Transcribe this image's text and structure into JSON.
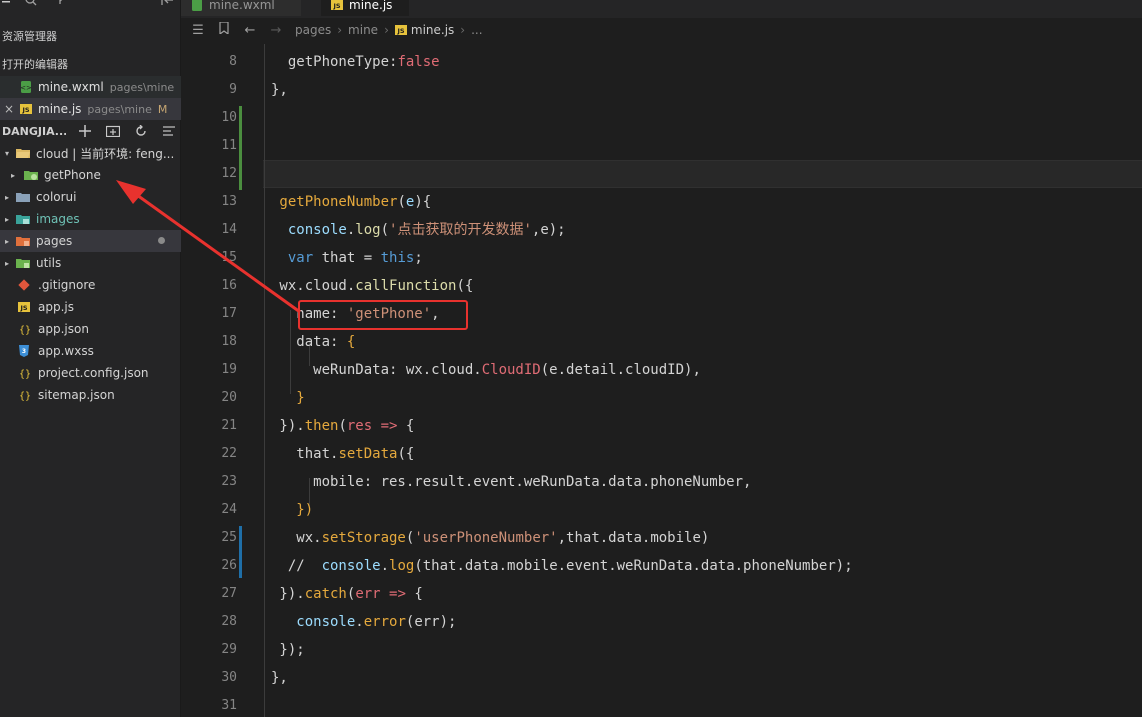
{
  "sidebar": {
    "panel_title": "资源管理器",
    "open_editors_title": "打开的编辑器",
    "open_editors": [
      {
        "name": "mine.wxml",
        "path": "pages\\mine",
        "modified": "",
        "close": ""
      },
      {
        "name": "mine.js",
        "path": "pages\\mine",
        "modified": "M",
        "close": "×"
      }
    ],
    "workspace_title": "DANGJIA...",
    "tree": [
      {
        "label": "cloud | 当前环境: feng...",
        "twisty": "▾",
        "icon": "folder-open-icon"
      },
      {
        "label": "getPhone",
        "twisty": "▸",
        "icon": "cloud-function-folder-icon"
      },
      {
        "label": "colorui",
        "twisty": "▸",
        "icon": "folder-icon"
      },
      {
        "label": "images",
        "twisty": "▸",
        "icon": "images-folder-icon"
      },
      {
        "label": "pages",
        "twisty": "▸",
        "icon": "pages-folder-icon"
      },
      {
        "label": "utils",
        "twisty": "▸",
        "icon": "utils-folder-icon"
      },
      {
        "label": ".gitignore",
        "twisty": "",
        "icon": "git-icon"
      },
      {
        "label": "app.js",
        "twisty": "",
        "icon": "js-file-icon"
      },
      {
        "label": "app.json",
        "twisty": "",
        "icon": "json-file-icon"
      },
      {
        "label": "app.wxss",
        "twisty": "",
        "icon": "css-file-icon"
      },
      {
        "label": "project.config.json",
        "twisty": "",
        "icon": "json-file-icon"
      },
      {
        "label": "sitemap.json",
        "twisty": "",
        "icon": "json-file-icon"
      }
    ]
  },
  "tabs": [
    {
      "label": "mine.wxml"
    },
    {
      "label": "mine.js"
    }
  ],
  "breadcrumb": [
    "pages",
    "mine",
    "mine.js",
    "..."
  ],
  "editor": {
    "line_numbers": [
      "8",
      "9",
      "10",
      "11",
      "12",
      "13",
      "14",
      "15",
      "16",
      "17",
      "18",
      "19",
      "20",
      "21",
      "22",
      "23",
      "24",
      "25",
      "26",
      "27",
      "28",
      "29",
      "30",
      "31"
    ],
    "lines": [
      "  getPhoneType:false",
      "},",
      "",
      "",
      "",
      " getPhoneNumber(e){",
      "  console.log('点击获取的开发数据',e);",
      "  var that = this;",
      " wx.cloud.callFunction({",
      "   name: 'getPhone',",
      "   data: {",
      "     weRunData: wx.cloud.CloudID(e.detail.cloudID),",
      "   }",
      " }).then(res => {",
      "   that.setData({",
      "     mobile: res.result.event.weRunData.data.phoneNumber,",
      "   })",
      "   wx.setStorage('userPhoneNumber',that.data.mobile)",
      "  //  console.log(that.data.mobile.event.weRunData.data.phoneNumber);",
      " }).catch(err => {",
      "   console.error(err);",
      " });",
      "},",
      ""
    ]
  },
  "colors": {
    "annotation": "#e8322e",
    "accent_green": "#4b8e3f",
    "accent_blue": "#1f6fa8"
  }
}
